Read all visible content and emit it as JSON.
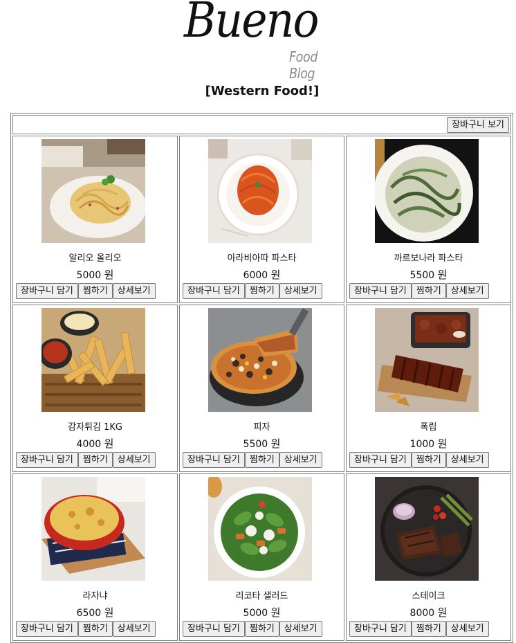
{
  "header": {
    "logo_main": "Bueno",
    "logo_sub": "Food Blog",
    "category": "[Western Food!]"
  },
  "toolbar": {
    "cart_view_label": "장바구니 보기"
  },
  "item_buttons": {
    "add_to_cart": "장바구니 담기",
    "wishlist": "찜하기",
    "details": "상세보기"
  },
  "products": [
    {
      "name": "알리오 올리오",
      "price": "5000",
      "unit": "원",
      "image": "aglio-olio-pasta"
    },
    {
      "name": "아라비아따 파스타",
      "price": "6000",
      "unit": "원",
      "image": "arrabbiata-pasta"
    },
    {
      "name": "까르보나라 파스타",
      "price": "5500",
      "unit": "원",
      "image": "carbonara-pasta"
    },
    {
      "name": "감자튀김 1KG",
      "price": "4000",
      "unit": "원",
      "image": "french-fries"
    },
    {
      "name": "피자",
      "price": "5500",
      "unit": "원",
      "image": "pizza"
    },
    {
      "name": "폭립",
      "price": "1000",
      "unit": "원",
      "image": "pork-ribs"
    },
    {
      "name": "라자냐",
      "price": "6500",
      "unit": "원",
      "image": "lasagna"
    },
    {
      "name": "리코타 샐러드",
      "price": "5000",
      "unit": "원",
      "image": "ricotta-salad"
    },
    {
      "name": "스테이크",
      "price": "8000",
      "unit": "원",
      "image": "steak"
    }
  ]
}
